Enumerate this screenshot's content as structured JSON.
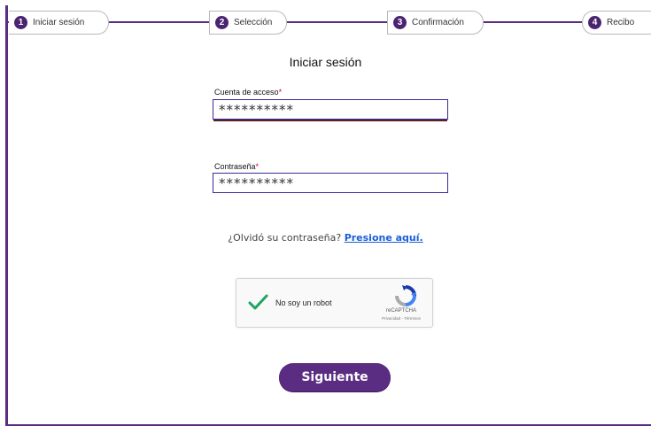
{
  "steps": [
    {
      "number": "1",
      "label": "Iniciar sesión"
    },
    {
      "number": "2",
      "label": "Selección"
    },
    {
      "number": "3",
      "label": "Confirmación"
    },
    {
      "number": "4",
      "label": "Recibo"
    }
  ],
  "form": {
    "title": "Iniciar sesión",
    "account_label": "Cuenta de acceso",
    "account_value": "**********",
    "password_label": "Contraseña",
    "password_value": "**********",
    "required_mark": "*"
  },
  "forgot": {
    "text": "¿Olvidó su contraseña? ",
    "link": "Presione aquí."
  },
  "captcha": {
    "label": "No soy un robot",
    "brand": "reCAPTCHA",
    "terms": "Privacidad - Términos",
    "checked": true
  },
  "buttons": {
    "next": "Siguiente"
  },
  "colors": {
    "brand_purple": "#5b2d82",
    "field_border": "#3a2b9a",
    "link_blue": "#1a5fd6",
    "required_red": "#d0021b",
    "check_green": "#1ea362"
  }
}
